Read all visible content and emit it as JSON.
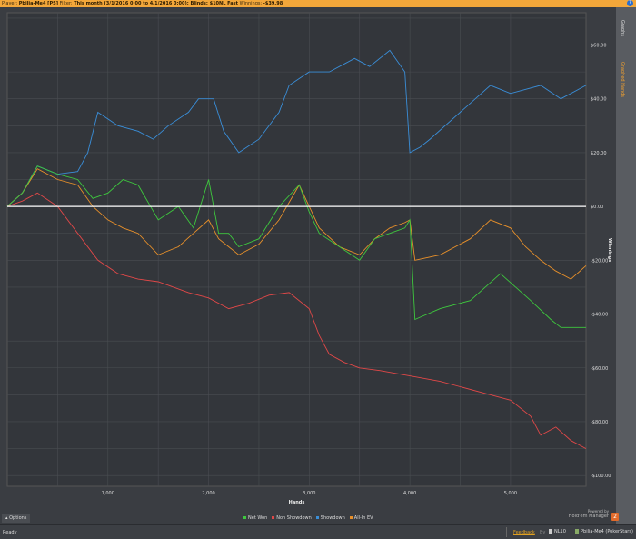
{
  "titlebar": {
    "player_label": "Player:",
    "player": "Pbilia-Me4 [PS]",
    "filter_label": "Filter:",
    "filter": "This month (3/1/2016 0:00 to 4/1/2016 0:00); Blinds: $10NL Fast",
    "winnings_label": "Winnings:",
    "winnings": "-$39.98",
    "help": "?"
  },
  "sidebar": {
    "tabs": [
      "Graphs",
      "Graphed Hands"
    ]
  },
  "options_label": "Options",
  "powered": {
    "line1": "Powered by",
    "line2": "Hold'em Manager",
    "logo": "2"
  },
  "status": {
    "ready": "Ready",
    "feedback": "Feedback",
    "by": "By",
    "stake": "NL10",
    "player": "Pbilia-Me4 (PokerStars)"
  },
  "colors": {
    "net_won": "#3ec83e",
    "non_showdown": "#e04848",
    "showdown": "#3a8ed8",
    "all_in_ev": "#e8902a",
    "bg": "#33363b",
    "grid": "#4a4d52"
  },
  "chart_data": {
    "type": "line",
    "xlabel": "Hands",
    "ylabel": "Winnings",
    "xlim": [
      0,
      5750
    ],
    "ylim": [
      -104,
      72
    ],
    "xticks": [
      1000,
      2000,
      3000,
      4000,
      5000
    ],
    "xtick_labels": [
      "1,000",
      "2,000",
      "3,000",
      "4,000",
      "5,000"
    ],
    "yticks": [
      60,
      40,
      20,
      0,
      -20,
      -40,
      -60,
      -80,
      -100
    ],
    "ytick_labels": [
      "$60.00",
      "$40.00",
      "$20.00",
      "$0.00",
      "-$20.00",
      "-$40.00",
      "-$60.00",
      "-$80.00",
      "-$100.00"
    ],
    "legend": {
      "position": "bottom",
      "entries": [
        "Net Won",
        "Non Showdown",
        "Showdown",
        "All-In EV"
      ]
    },
    "series": [
      {
        "name": "Net Won",
        "color": "#3ec83e",
        "x": [
          0,
          150,
          300,
          500,
          700,
          850,
          1000,
          1150,
          1300,
          1500,
          1700,
          1850,
          2000,
          2100,
          2200,
          2300,
          2500,
          2700,
          2900,
          3000,
          3100,
          3300,
          3500,
          3650,
          3800,
          3950,
          4000,
          4050,
          4300,
          4600,
          4900,
          5050,
          5200,
          5400,
          5500,
          5750
        ],
        "y": [
          0,
          5,
          15,
          12,
          10,
          3,
          5,
          10,
          8,
          -5,
          0,
          -8,
          10,
          -10,
          -10,
          -15,
          -12,
          0,
          8,
          -2,
          -10,
          -15,
          -20,
          -12,
          -10,
          -8,
          -5,
          -42,
          -38,
          -35,
          -25,
          -30,
          -35,
          -42,
          -45,
          -45
        ]
      },
      {
        "name": "All-In EV",
        "color": "#e8902a",
        "x": [
          0,
          150,
          300,
          500,
          700,
          850,
          1000,
          1150,
          1300,
          1500,
          1700,
          1850,
          2000,
          2100,
          2200,
          2300,
          2500,
          2700,
          2900,
          3000,
          3100,
          3300,
          3500,
          3650,
          3800,
          3950,
          4000,
          4050,
          4300,
          4600,
          4800,
          5000,
          5150,
          5300,
          5450,
          5600,
          5750
        ],
        "y": [
          0,
          5,
          14,
          10,
          8,
          0,
          -5,
          -8,
          -10,
          -18,
          -15,
          -10,
          -5,
          -12,
          -15,
          -18,
          -14,
          -5,
          8,
          0,
          -8,
          -15,
          -18,
          -12,
          -8,
          -6,
          -5,
          -20,
          -18,
          -12,
          -5,
          -8,
          -15,
          -20,
          -24,
          -27,
          -22
        ]
      },
      {
        "name": "Showdown",
        "color": "#3a8ed8",
        "x": [
          0,
          150,
          300,
          500,
          700,
          800,
          900,
          1100,
          1300,
          1450,
          1600,
          1800,
          1900,
          2050,
          2150,
          2300,
          2500,
          2700,
          2800,
          3000,
          3200,
          3450,
          3600,
          3800,
          3950,
          4000,
          4100,
          4200,
          4500,
          4800,
          5000,
          5300,
          5500,
          5750
        ],
        "y": [
          0,
          5,
          15,
          12,
          13,
          20,
          35,
          30,
          28,
          25,
          30,
          35,
          40,
          40,
          28,
          20,
          25,
          35,
          45,
          50,
          50,
          55,
          52,
          58,
          50,
          20,
          22,
          25,
          35,
          45,
          42,
          45,
          40,
          45
        ]
      },
      {
        "name": "Non Showdown",
        "color": "#e04848",
        "x": [
          0,
          150,
          300,
          500,
          700,
          900,
          1100,
          1300,
          1500,
          1800,
          2000,
          2200,
          2400,
          2600,
          2800,
          3000,
          3100,
          3200,
          3350,
          3500,
          3700,
          4000,
          4300,
          4500,
          4800,
          5000,
          5200,
          5300,
          5450,
          5600,
          5750
        ],
        "y": [
          0,
          2,
          5,
          0,
          -10,
          -20,
          -25,
          -27,
          -28,
          -32,
          -34,
          -38,
          -36,
          -33,
          -32,
          -38,
          -48,
          -55,
          -58,
          -60,
          -61,
          -63,
          -65,
          -67,
          -70,
          -72,
          -78,
          -85,
          -82,
          -87,
          -90
        ]
      }
    ]
  }
}
